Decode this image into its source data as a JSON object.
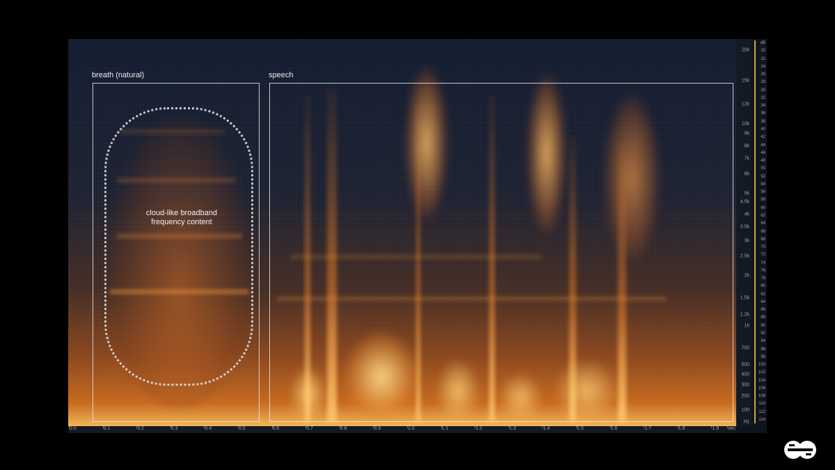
{
  "regions": {
    "breath_label": "breath (natural)",
    "speech_label": "speech",
    "annotation_line1": "cloud-like broadband",
    "annotation_line2": "frequency content"
  },
  "frequency_axis": {
    "labels": [
      "20k",
      "15k",
      "12k",
      "10k",
      "9k",
      "8k",
      "7k",
      "6k",
      "5k",
      "4.5k",
      "4k",
      "3.5k",
      "3k",
      "2.5k",
      "2k",
      "1.5k",
      "1.2k",
      "1k",
      "700",
      "500",
      "400",
      "300",
      "200",
      "100",
      "Hz"
    ]
  },
  "db_axis": {
    "labels": [
      "dB",
      "20",
      "22",
      "24",
      "26",
      "28",
      "30",
      "32",
      "34",
      "36",
      "38",
      "40",
      "42",
      "44",
      "46",
      "48",
      "50",
      "52",
      "54",
      "56",
      "58",
      "60",
      "62",
      "64",
      "66",
      "68",
      "70",
      "72",
      "74",
      "76",
      "78",
      "80",
      "82",
      "84",
      "86",
      "88",
      "90",
      "92",
      "94",
      "96",
      "98",
      "100",
      "102",
      "104",
      "106",
      "108",
      "110",
      "112",
      "114"
    ]
  },
  "time_axis": {
    "labels": [
      "0.0",
      "0.1",
      "0.2",
      "0.3",
      "0.4",
      "0.5",
      "0.6",
      "0.7",
      "0.8",
      "0.9",
      "1.0",
      "1.1",
      "1.2",
      "1.3",
      "1.4",
      "1.5",
      "1.6",
      "1.7",
      "1.8",
      "1.9",
      "sec"
    ]
  },
  "colors": {
    "accent": "#e8892a",
    "background": "#000000",
    "box": "#e6e6e6"
  },
  "logo": {
    "icon": "brand-logo-icon"
  }
}
